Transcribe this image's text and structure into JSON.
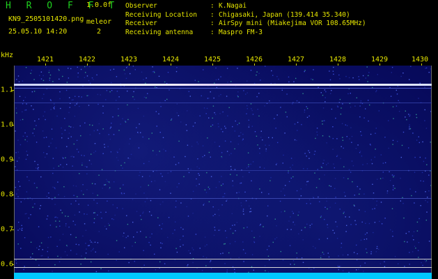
{
  "header": {
    "brand": "H R O F F T",
    "version": "1.0.0f",
    "filename": "KN9_2505101420.png",
    "timestamp": "25.05.10 14:20",
    "meteor_label": "meleor",
    "meteor_count": "2",
    "info": [
      {
        "key": "Observer",
        "sep": ":",
        "value": "K.Nagai"
      },
      {
        "key": "Receiving Location",
        "sep": ":",
        "value": "Chigasaki, Japan (139.414 35.340)"
      },
      {
        "key": "Receiver",
        "sep": ":",
        "value": "AirSpy mini (Miakejima VOR 108.65MHz)"
      },
      {
        "key": "Receiving antenna",
        "sep": ":",
        "value": "Maspro FM-3"
      }
    ]
  },
  "plot": {
    "y_unit": "kHz",
    "x_ticks": [
      "1421",
      "1422",
      "1423",
      "1424",
      "1425",
      "1426",
      "1427",
      "1428",
      "1429",
      "1430"
    ],
    "y_ticks": [
      "1.1",
      "1.0",
      "0.9",
      "0.8",
      "0.7",
      "0.6"
    ],
    "colors": {
      "background": "#060858",
      "trace_strong": "#e8e8ff",
      "trace_faint": "#6a7ad8",
      "bottom_band": "#00d8ff"
    }
  }
}
